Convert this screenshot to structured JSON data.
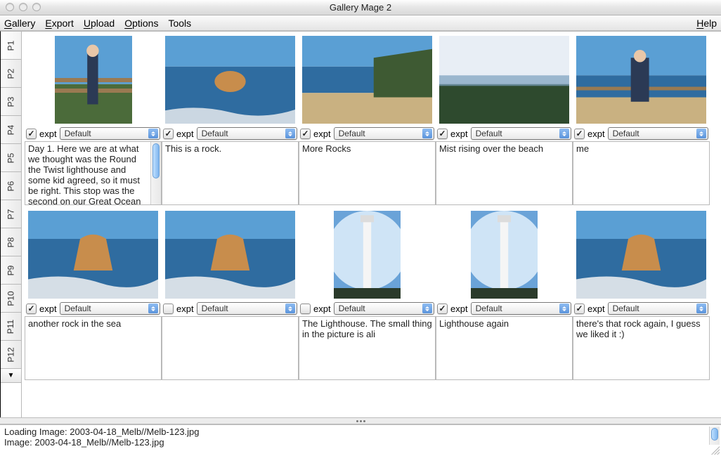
{
  "window": {
    "title": "Gallery Mage 2"
  },
  "menubar": {
    "items": [
      {
        "label": "Gallery",
        "accel_index": 0
      },
      {
        "label": "Export",
        "accel_index": 0
      },
      {
        "label": "Upload",
        "accel_index": 0
      },
      {
        "label": "Options",
        "accel_index": 0
      },
      {
        "label": "Tools",
        "accel_index": -1
      }
    ],
    "help": {
      "label": "Help",
      "accel_index": 0
    }
  },
  "sidebar": {
    "pages": [
      "P1",
      "P2",
      "P3",
      "P4",
      "P5",
      "P6",
      "P7",
      "P8",
      "P9",
      "P10",
      "P11",
      "P12"
    ],
    "active_index": 0,
    "expand_icon": "▼"
  },
  "controls": {
    "expt_label": "expt",
    "select_default": "Default"
  },
  "thumbnails": [
    {
      "thumb": "person-fence",
      "checked": true,
      "select": "Default",
      "caption": "Day 1.  Here we are at what we thought was the Round the Twist lighthouse and some kid agreed, so it must be right.  This stop was the second on our Great Ocean ",
      "has_scrollbar": true
    },
    {
      "thumb": "rock-ocean-1",
      "checked": true,
      "select": "Default",
      "caption": "This is a rock."
    },
    {
      "thumb": "beach-cliff",
      "checked": true,
      "select": "Default",
      "caption": "More Rocks"
    },
    {
      "thumb": "mist-beach",
      "checked": true,
      "select": "Default",
      "caption": "Mist rising over the beach"
    },
    {
      "thumb": "person-beach",
      "checked": true,
      "select": "Default",
      "caption": "me"
    },
    {
      "thumb": "rock-ocean-2",
      "checked": true,
      "select": "Default",
      "caption": "another rock in the sea"
    },
    {
      "thumb": "rock-ocean-2",
      "checked": false,
      "select": "Default",
      "caption": ""
    },
    {
      "thumb": "lighthouse-1",
      "checked": false,
      "select": "Default",
      "caption": "The Lighthouse.  The small thing in the picture is ali"
    },
    {
      "thumb": "lighthouse-2",
      "checked": true,
      "select": "Default",
      "caption": "Lighthouse again"
    },
    {
      "thumb": "rock-ocean-2",
      "checked": true,
      "select": "Default",
      "caption": "there's that rock again, I guess we liked it :)"
    }
  ],
  "status": {
    "lines": [
      "Loading Image: 2003-04-18_Melb//Melb-123.jpg",
      "Image: 2003-04-18_Melb//Melb-123.jpg"
    ]
  }
}
